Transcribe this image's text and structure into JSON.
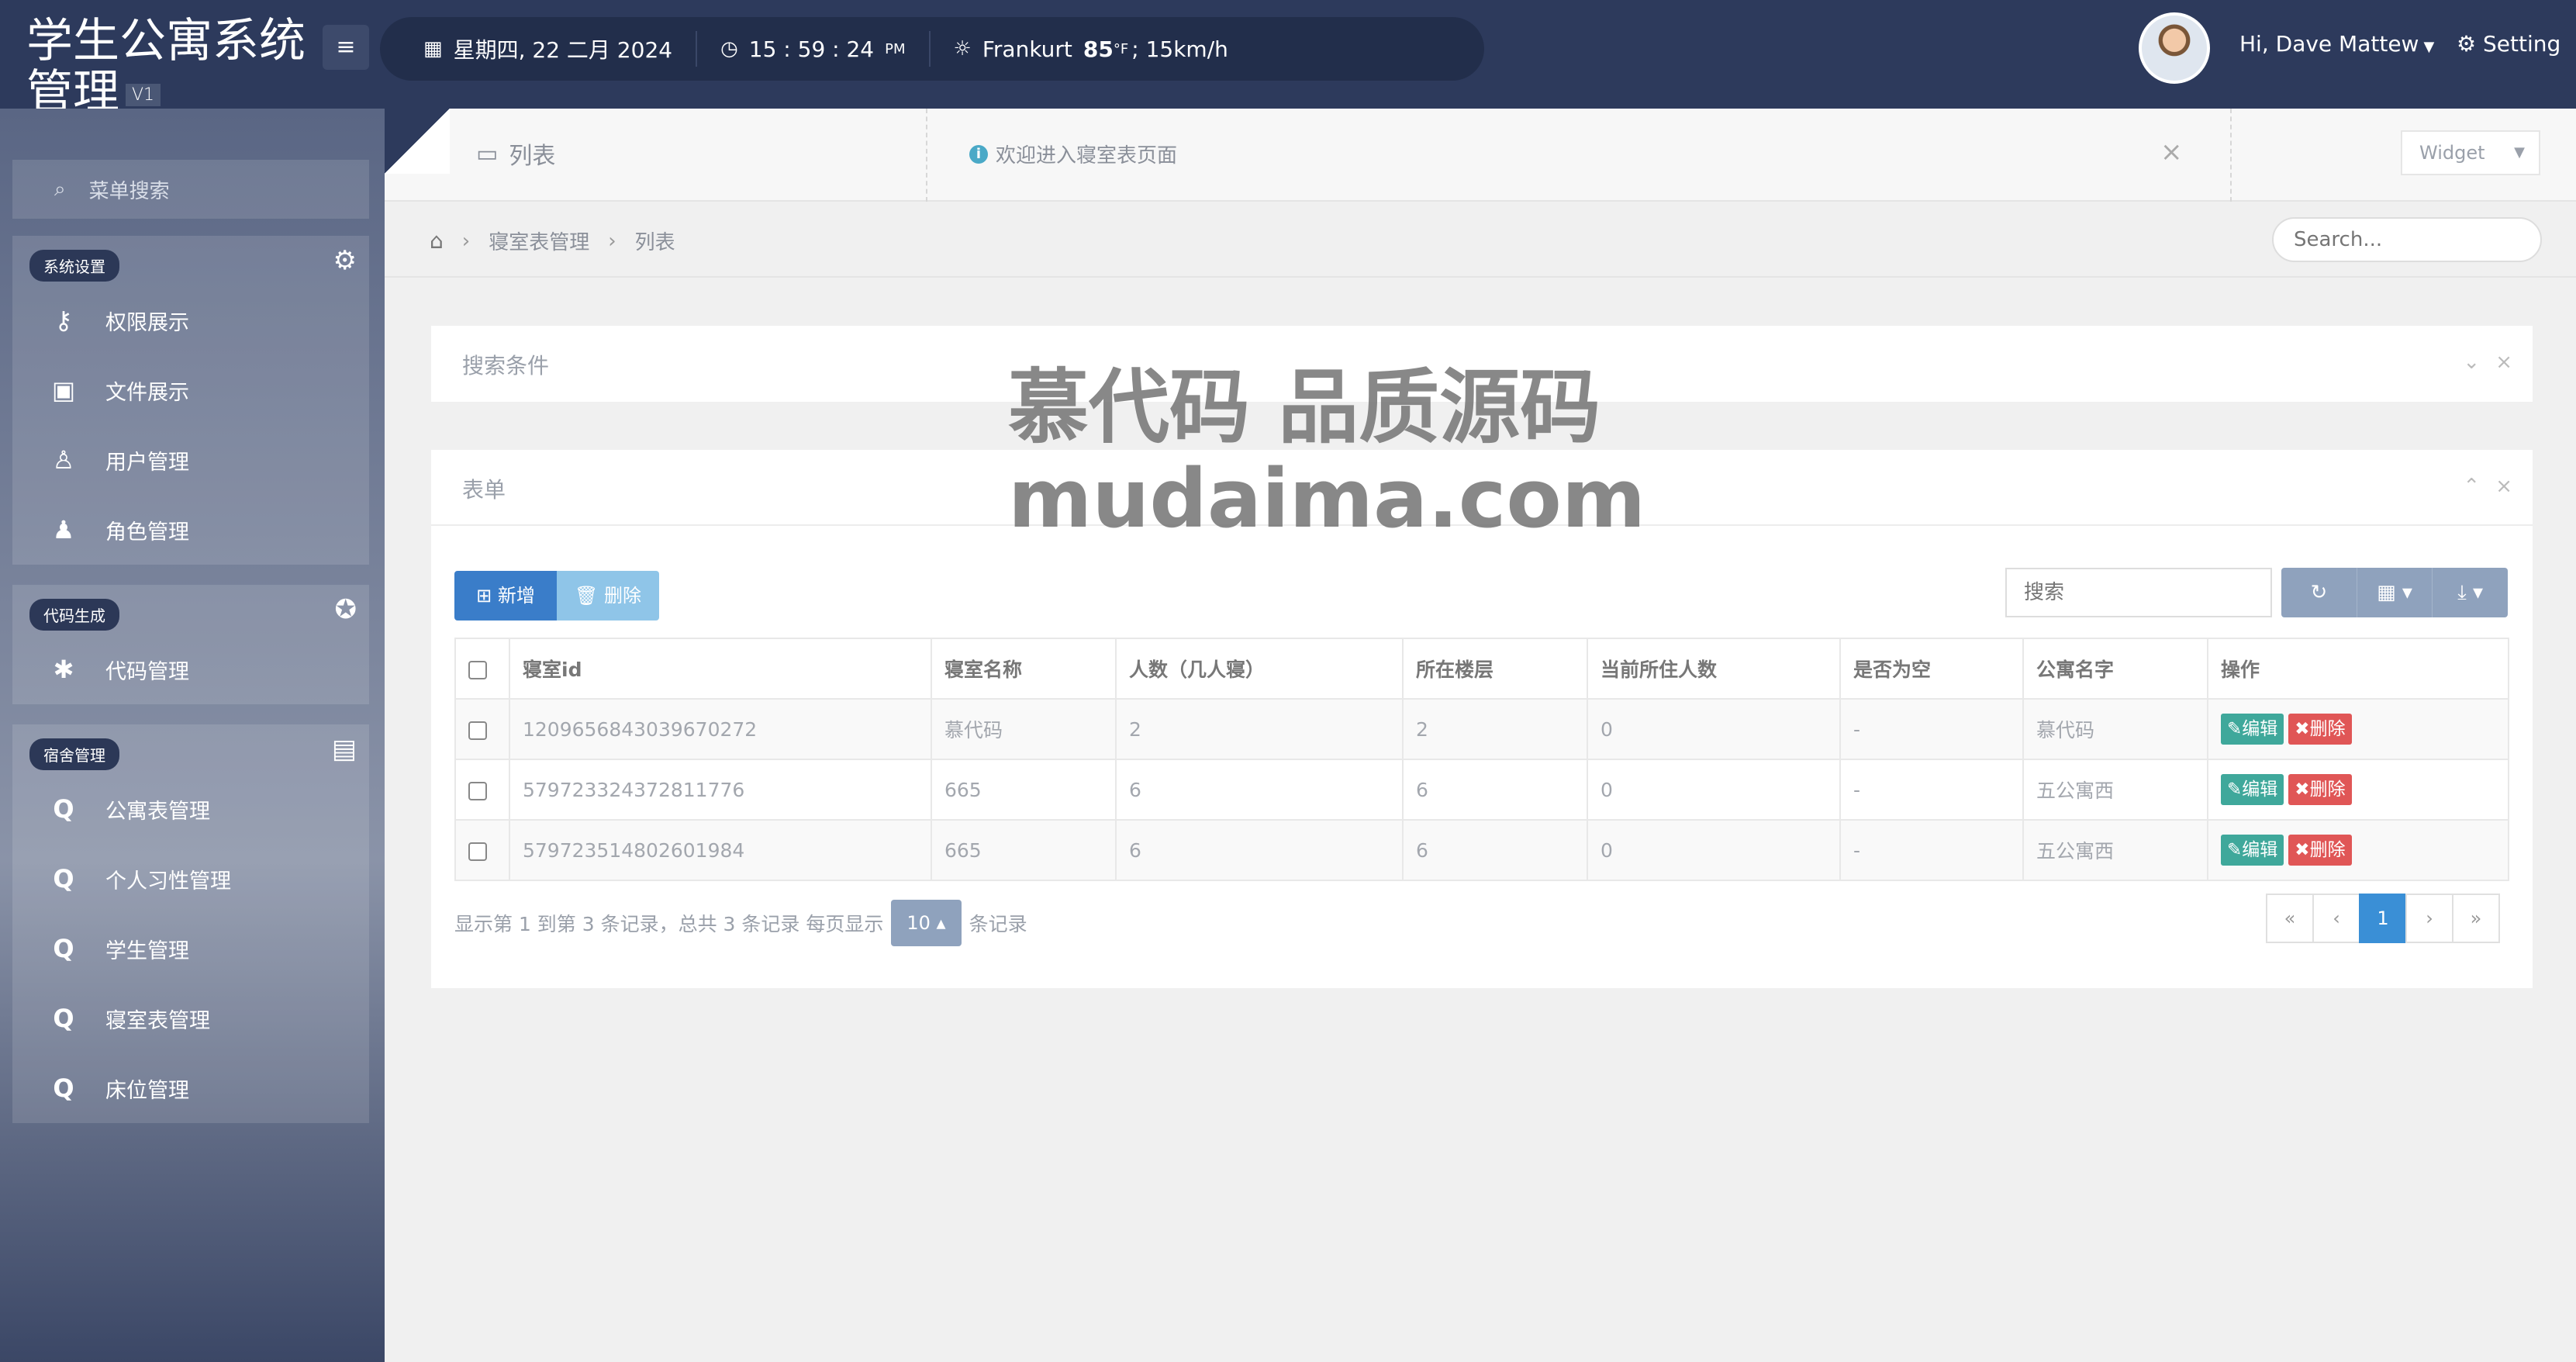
{
  "app": {
    "title": "学生公寓系统管理",
    "version": "V1",
    "menu_toggle": "≡"
  },
  "infobar": {
    "date": "星期四, 22 二月 2024",
    "time": "15 : 59 : 24",
    "ampm": "PM",
    "city": "Frankurt",
    "temp": "85",
    "temp_unit": "°F",
    "wind": "; 15km/h"
  },
  "user": {
    "greeting": "Hi, Dave Mattew",
    "setting_label": "Setting"
  },
  "sidebar": {
    "search_label": "菜单搜索",
    "groups": [
      {
        "tag": "系统设置",
        "items": [
          {
            "label": "权限展示",
            "icon": "key-icon"
          },
          {
            "label": "文件展示",
            "icon": "image-icon"
          },
          {
            "label": "用户管理",
            "icon": "user-icon"
          },
          {
            "label": "角色管理",
            "icon": "users-icon"
          }
        ]
      },
      {
        "tag": "代码生成",
        "items": [
          {
            "label": "代码管理",
            "icon": "bug-icon"
          }
        ]
      },
      {
        "tag": "宿舍管理",
        "items": [
          {
            "label": "公寓表管理",
            "icon": "q-icon"
          },
          {
            "label": "个人习性管理",
            "icon": "q-icon"
          },
          {
            "label": "学生管理",
            "icon": "q-icon"
          },
          {
            "label": "寝室表管理",
            "icon": "q-icon"
          },
          {
            "label": "床位管理",
            "icon": "q-icon"
          }
        ]
      }
    ]
  },
  "tabbar": {
    "title": "列表",
    "notice": "欢迎进入寝室表页面",
    "widget_label": "Widget"
  },
  "breadcrumb": {
    "items": [
      "寝室表管理",
      "列表"
    ],
    "search_placeholder": "Search..."
  },
  "search_panel": {
    "title": "搜索条件"
  },
  "table_panel": {
    "title": "表单",
    "add_label": "新增",
    "delete_label": "删除",
    "search_placeholder": "搜索",
    "columns": [
      "寝室id",
      "寝室名称",
      "人数（几人寝）",
      "所在楼层",
      "当前所住人数",
      "是否为空",
      "公寓名字",
      "操作"
    ],
    "rows": [
      [
        "1209656843039670272",
        "慕代码",
        "2",
        "2",
        "0",
        "-",
        "慕代码"
      ],
      [
        "579723324372811776",
        "665",
        "6",
        "6",
        "0",
        "-",
        "五公寓西"
      ],
      [
        "579723514802601984",
        "665",
        "6",
        "6",
        "0",
        "-",
        "五公寓西"
      ]
    ],
    "edit_label": "编辑",
    "row_delete_label": "删除",
    "pagination_info": "显示第 1 到第 3 条记录，总共 3 条记录 每页显示",
    "page_size": "10",
    "pagination_suffix": "条记录",
    "pages": [
      "«",
      "‹",
      "1",
      "›",
      "»"
    ],
    "current_page": "1"
  },
  "watermark": {
    "line1": "慕代码 品质源码",
    "line2": "mudaima.com"
  },
  "colors": {
    "topbar": "#2d3a5c",
    "primary": "#3a7dc9",
    "edit": "#3fa89b",
    "delete": "#e05656"
  }
}
